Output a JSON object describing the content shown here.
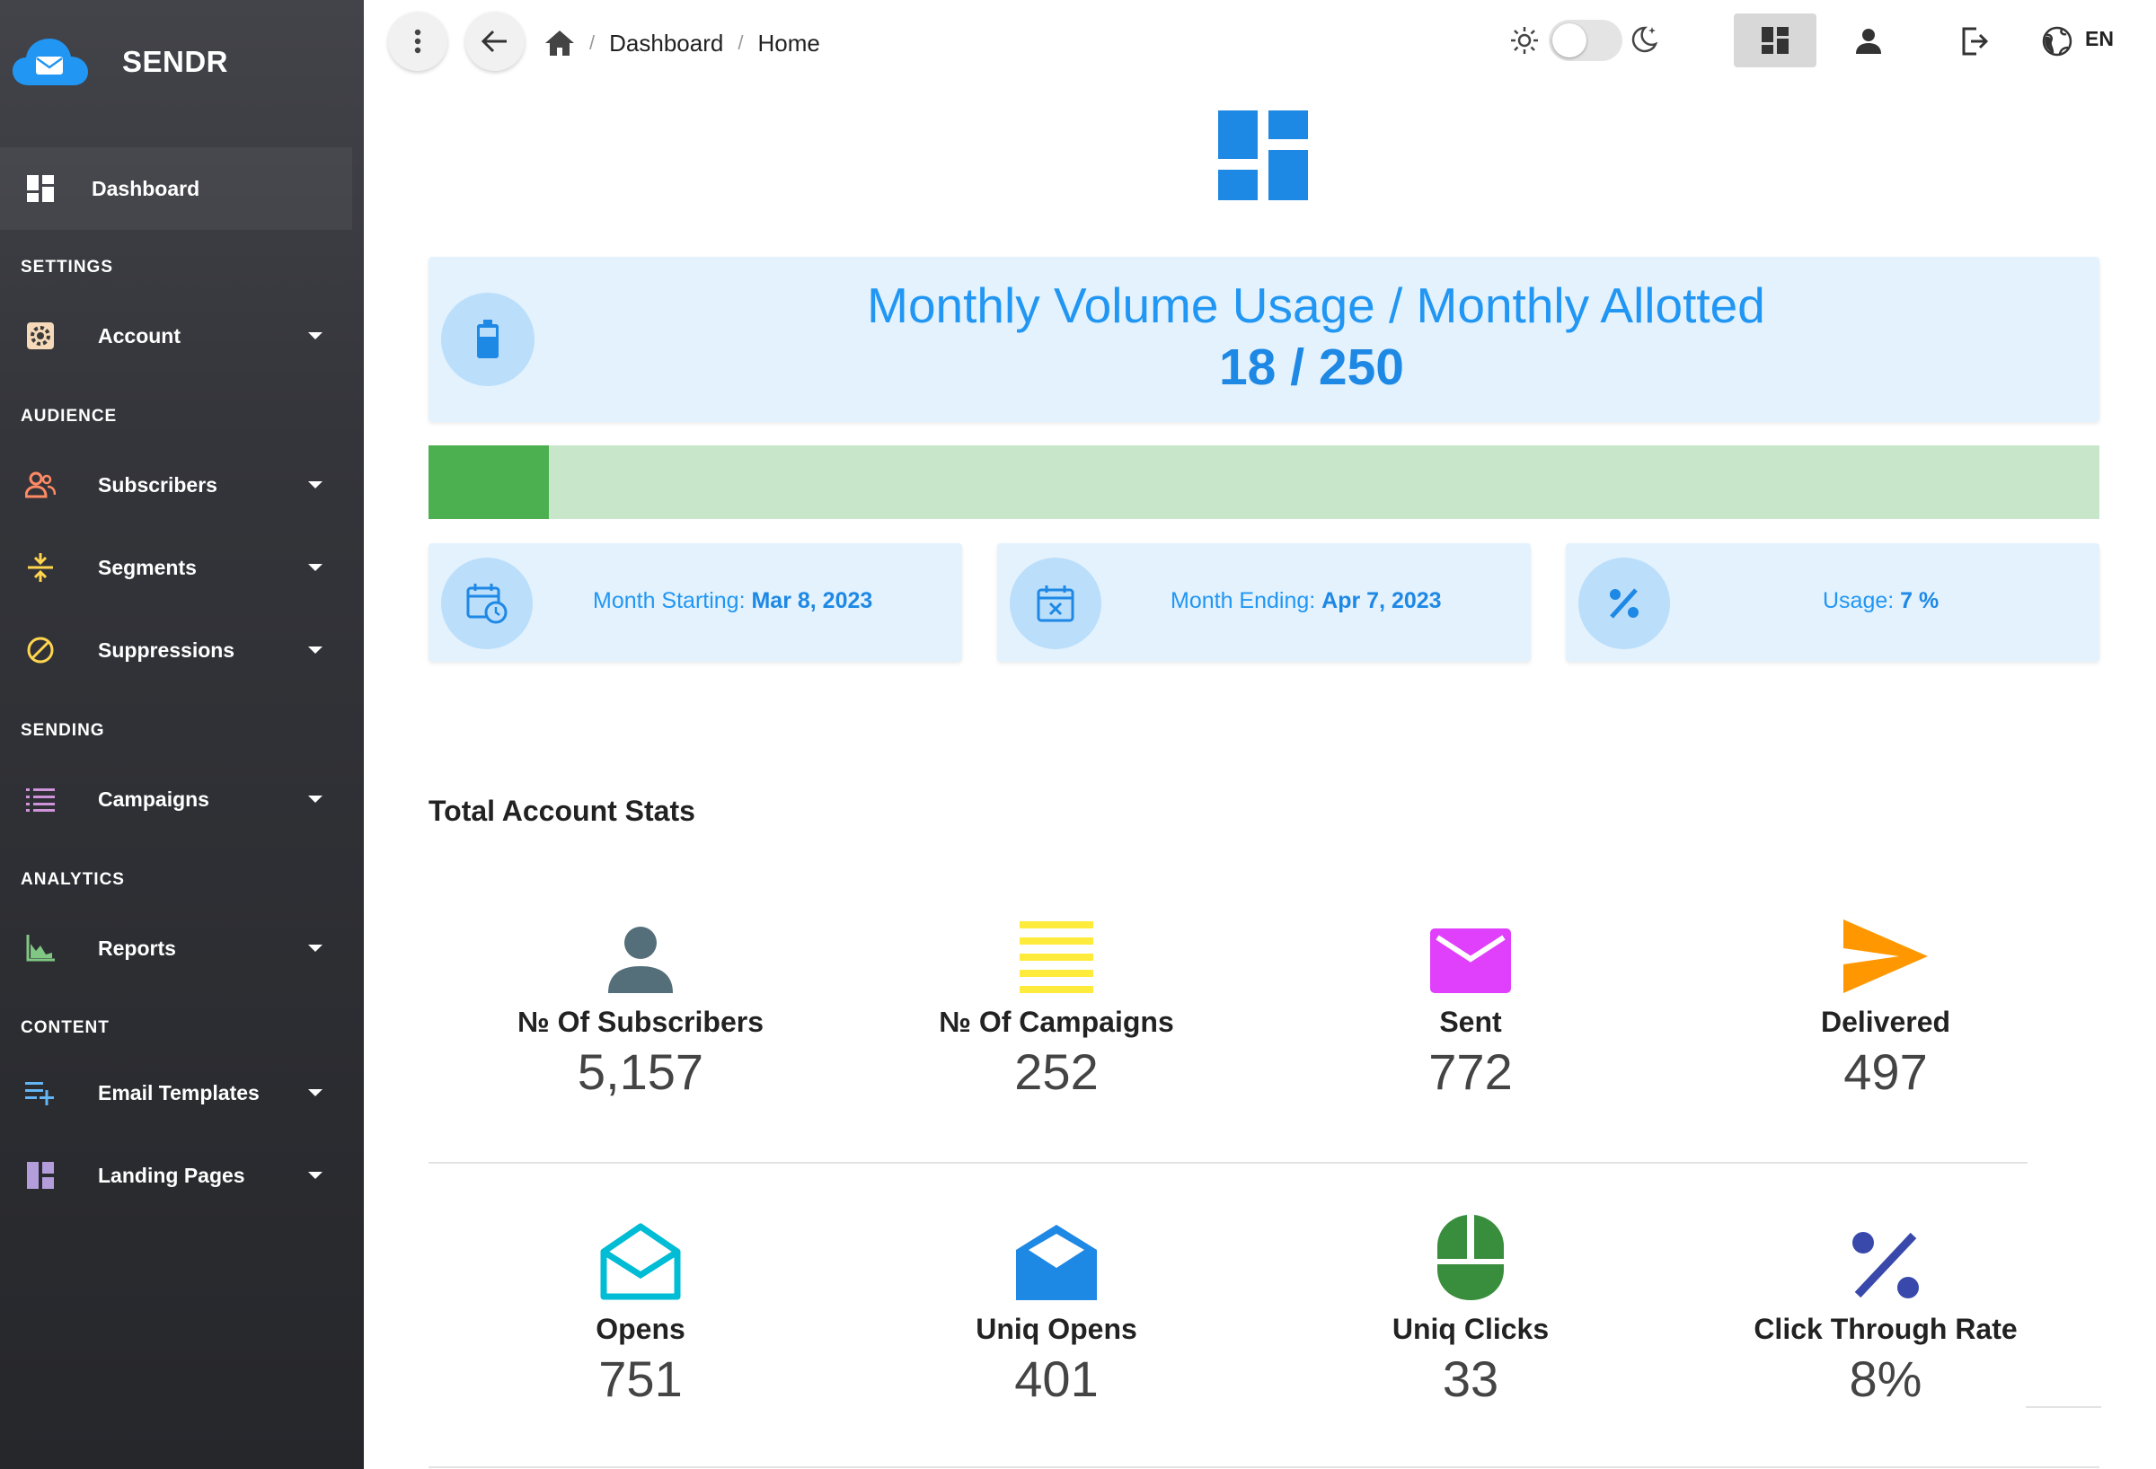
{
  "brand": {
    "name": "SENDR"
  },
  "sidebar": {
    "dashboard": {
      "label": "Dashboard",
      "icon": "dashboard-icon"
    },
    "sections": {
      "settings": "SETTINGS",
      "audience": "AUDIENCE",
      "sending": "SENDING",
      "analytics": "ANALYTICS",
      "content": "CONTENT"
    },
    "items": {
      "account": {
        "label": "Account",
        "icon": "gear-icon"
      },
      "subscribers": {
        "label": "Subscribers",
        "icon": "people-icon"
      },
      "segments": {
        "label": "Segments",
        "icon": "segments-icon"
      },
      "suppressions": {
        "label": "Suppressions",
        "icon": "block-icon"
      },
      "campaigns": {
        "label": "Campaigns",
        "icon": "list-icon"
      },
      "reports": {
        "label": "Reports",
        "icon": "chart-icon"
      },
      "email_templates": {
        "label": "Email Templates",
        "icon": "playlist-add-icon"
      },
      "landing_pages": {
        "label": "Landing Pages",
        "icon": "layout-icon"
      }
    }
  },
  "topbar": {
    "breadcrumb": [
      "Dashboard",
      "Home"
    ],
    "separator": "/",
    "language": "EN"
  },
  "usage": {
    "title": "Monthly Volume Usage / Monthly Allotted",
    "value": "18 / 250",
    "used": 18,
    "allotted": 250,
    "progress_fraction": 0.072
  },
  "period": {
    "start_label": "Month Starting:",
    "start_value": "Mar 8, 2023",
    "end_label": "Month Ending:",
    "end_value": "Apr 7, 2023",
    "usage_label": "Usage:",
    "usage_value": "7 %"
  },
  "stats": {
    "heading": "Total Account Stats",
    "subscribers": {
      "label": "№ Of Subscribers",
      "value": "5,157",
      "icon": "person-icon"
    },
    "campaigns": {
      "label": "№ Of Campaigns",
      "value": "252",
      "icon": "lines-icon"
    },
    "sent": {
      "label": "Sent",
      "value": "772",
      "icon": "mail-icon"
    },
    "delivered": {
      "label": "Delivered",
      "value": "497",
      "icon": "send-icon"
    },
    "opens": {
      "label": "Opens",
      "value": "751",
      "icon": "open-mail-icon"
    },
    "uniq_opens": {
      "label": "Uniq Opens",
      "value": "401",
      "icon": "open-mail-filled-icon"
    },
    "uniq_clicks": {
      "label": "Uniq Clicks",
      "value": "33",
      "icon": "mouse-icon"
    },
    "ctr": {
      "label": "Click Through Rate",
      "value": "8%",
      "icon": "percent-icon"
    }
  },
  "colors": {
    "accent": "#2196f3",
    "sidebar": "#2f3034",
    "progress_fill": "#4caf50",
    "progress_track": "#c8e6c9",
    "card_bg": "#e3f2fd"
  }
}
